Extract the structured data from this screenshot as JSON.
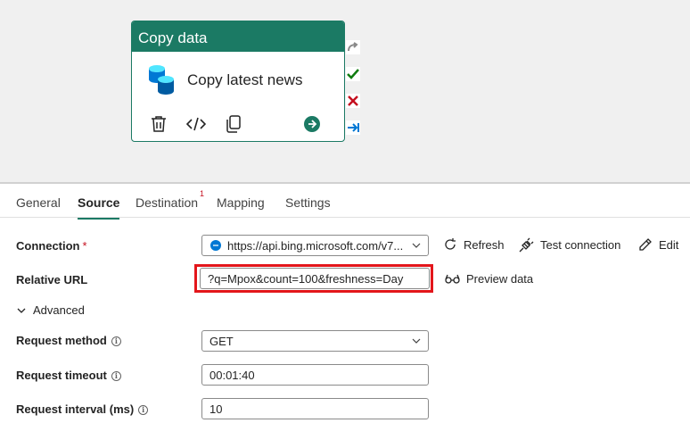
{
  "activity": {
    "type_label": "Copy data",
    "name": "Copy latest news",
    "icons": [
      "database-icon",
      "delete-icon",
      "code-icon",
      "copy-icon",
      "go-arrow-icon"
    ]
  },
  "side_icons": [
    "skip-arrow-icon",
    "success-check-icon",
    "fail-x-icon",
    "completion-arrow-icon"
  ],
  "tabs": [
    {
      "label": "General",
      "active": false
    },
    {
      "label": "Source",
      "active": true
    },
    {
      "label": "Destination",
      "active": false,
      "badge": "1"
    },
    {
      "label": "Mapping",
      "active": false
    },
    {
      "label": "Settings",
      "active": false
    }
  ],
  "form": {
    "connection": {
      "label": "Connection",
      "required_mark": "*",
      "value": "https://api.bing.microsoft.com/v7..."
    },
    "relative_url": {
      "label": "Relative URL",
      "value": "?q=Mpox&count=100&freshness=Day"
    },
    "advanced_label": "Advanced",
    "request_method": {
      "label": "Request method",
      "value": "GET"
    },
    "request_timeout": {
      "label": "Request timeout",
      "value": "00:01:40"
    },
    "request_interval": {
      "label": "Request interval (ms)",
      "value": "10"
    }
  },
  "actions": {
    "refresh": "Refresh",
    "test_connection": "Test connection",
    "edit": "Edit",
    "preview_data": "Preview data"
  },
  "colors": {
    "accent": "#1b7a64",
    "highlight": "#e3161b",
    "required": "#c50f1f"
  }
}
